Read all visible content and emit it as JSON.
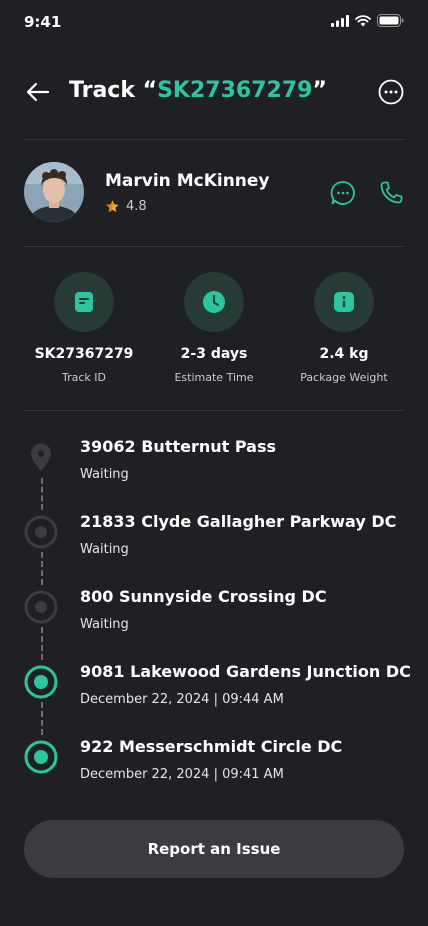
{
  "status_bar": {
    "time": "9:41"
  },
  "header": {
    "title_prefix": "Track “",
    "tracking_id": "SK27367279",
    "title_suffix": "”"
  },
  "courier": {
    "name": "Marvin McKinney",
    "rating": "4.8"
  },
  "stats": [
    {
      "value": "SK27367279",
      "label": "Track ID",
      "icon": "document-icon"
    },
    {
      "value": "2-3 days",
      "label": "Estimate Time",
      "icon": "clock-icon"
    },
    {
      "value": "2.4 kg",
      "label": "Package Weight",
      "icon": "info-icon"
    }
  ],
  "timeline": [
    {
      "title": "39062 Butternut Pass",
      "subtitle": "Waiting",
      "state": "destination"
    },
    {
      "title": "21833 Clyde Gallagher Parkway DC",
      "subtitle": "Waiting",
      "state": "pending"
    },
    {
      "title": "800 Sunnyside Crossing DC",
      "subtitle": "Waiting",
      "state": "pending"
    },
    {
      "title": "9081 Lakewood Gardens Junction DC",
      "subtitle": "December 22, 2024 | 09:44 AM",
      "state": "done"
    },
    {
      "title": "922 Messerschmidt Circle DC",
      "subtitle": "December 22, 2024 | 09:41 AM",
      "state": "done"
    }
  ],
  "report_button": {
    "label": "Report an Issue"
  },
  "colors": {
    "accent": "#2bc6a0",
    "background": "#1f2023",
    "pending": "#3a3c41",
    "button": "#3a3c41"
  }
}
